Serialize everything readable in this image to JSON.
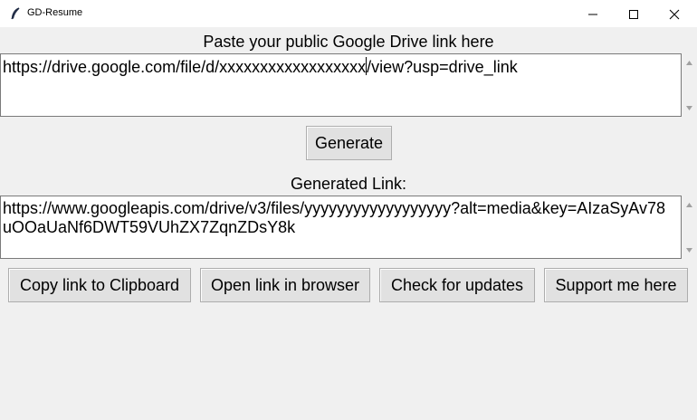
{
  "window": {
    "title": "GD-Resume"
  },
  "input_section": {
    "label": "Paste your public Google Drive link here",
    "value_before_caret": "https://drive.google.com/file/d/xxxxxxxxxxxxxxxxxx",
    "value_after_caret": "/view?usp=drive_link"
  },
  "generate_button": {
    "label": "Generate"
  },
  "output_section": {
    "label": "Generated Link:",
    "value": "https://www.googleapis.com/drive/v3/files/yyyyyyyyyyyyyyyyyy?alt=media&key=AIzaSyAv78uOOaUaNf6DWT59VUhZX7ZqnZDsY8k"
  },
  "actions": {
    "copy": "Copy link to Clipboard",
    "open": "Open link in browser",
    "updates": "Check for updates",
    "support": "Support me here"
  },
  "icons": {
    "app": "feather-icon",
    "minimize": "minimize-icon",
    "maximize": "maximize-icon",
    "close": "close-icon"
  }
}
